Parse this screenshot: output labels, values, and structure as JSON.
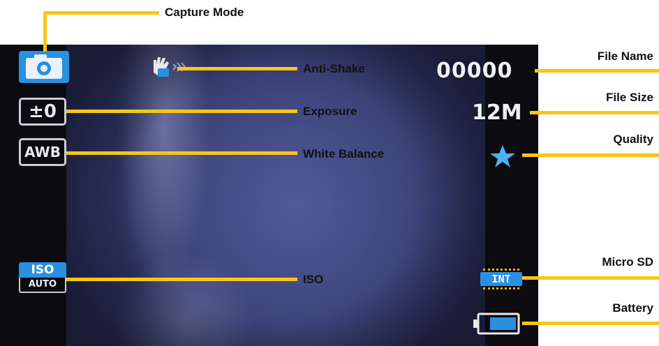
{
  "screen": {
    "file_name": "00000",
    "file_size": "12M",
    "exposure_value": "±0",
    "white_balance_value": "AWB",
    "iso_top": "ISO",
    "iso_bottom": "AUTO",
    "storage_value": "INT",
    "capture_mode_icon": "camera-icon",
    "anti_shake_icon": "hand-shake-icon",
    "quality_icon": "star-icon",
    "battery_icon": "battery-icon",
    "battery_level": 0.67
  },
  "callouts": {
    "capture_mode": "Capture Mode",
    "anti_shake": "Anti-Shake",
    "exposure": "Exposure",
    "white_balance": "White Balance",
    "iso": "ISO",
    "file_name": "File Name",
    "file_size": "File Size",
    "quality": "Quality",
    "micro_sd": "Micro SD",
    "battery": "Battery"
  },
  "colors": {
    "callout_line": "#fbc613",
    "osd_blue": "#2a8fe0",
    "star": "#4ab2f2"
  }
}
